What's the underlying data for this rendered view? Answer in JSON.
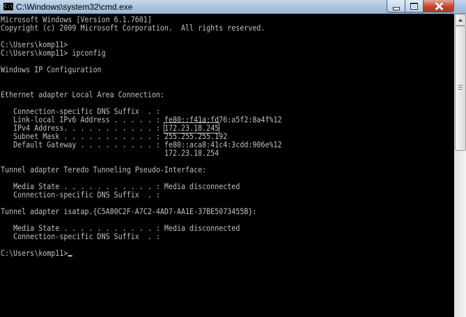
{
  "window": {
    "title": "C:\\Windows\\system32\\cmd.exe",
    "icon_text": "C:\\"
  },
  "console": {
    "lines": [
      "Microsoft Windows [Version 6.1.7601]",
      "Copyright (c) 2009 Microsoft Corporation.  All rights reserved.",
      "",
      "C:\\Users\\komp11>",
      "C:\\Users\\komp11> ipconfig",
      "",
      "Windows IP Configuration",
      "",
      "",
      "Ethernet adapter Local Area Connection:",
      "",
      "   Connection-specific DNS Suffix  . :",
      "   Link-local IPv6 Address . . . . . : fe80::f41a:fd76:a5f2:8a4f%12",
      "   IPv4 Address. . . . . . . . . . . :",
      "   Subnet Mask . . . . . . . . . . . : 255.255.255.192",
      "   Default Gateway . . . . . . . . . : fe80::aca8:41c4:3cdd:906e%12",
      "                                       172.23.18.254",
      "",
      "Tunnel adapter Teredo Tunneling Pseudo-Interface:",
      "",
      "   Media State . . . . . . . . . . . : Media disconnected",
      "   Connection-specific DNS Suffix  . :",
      "",
      "Tunnel adapter isatap.{C5A80C2F-A7C2-4AD7-AA1E-37BE5073455B}:",
      "",
      "   Media State . . . . . . . . . . . : Media disconnected",
      "   Connection-specific DNS Suffix  . :",
      "",
      "C:\\Users\\komp11>"
    ],
    "ipv4_value": "172.23.18.245"
  },
  "colors": {
    "console_bg": "#000000",
    "console_fg": "#c0c0c0",
    "close_button": "#c2452e"
  },
  "icons": [
    "cmd-app-icon",
    "minimize-icon",
    "maximize-icon",
    "close-icon",
    "scroll-up-arrow-icon"
  ]
}
